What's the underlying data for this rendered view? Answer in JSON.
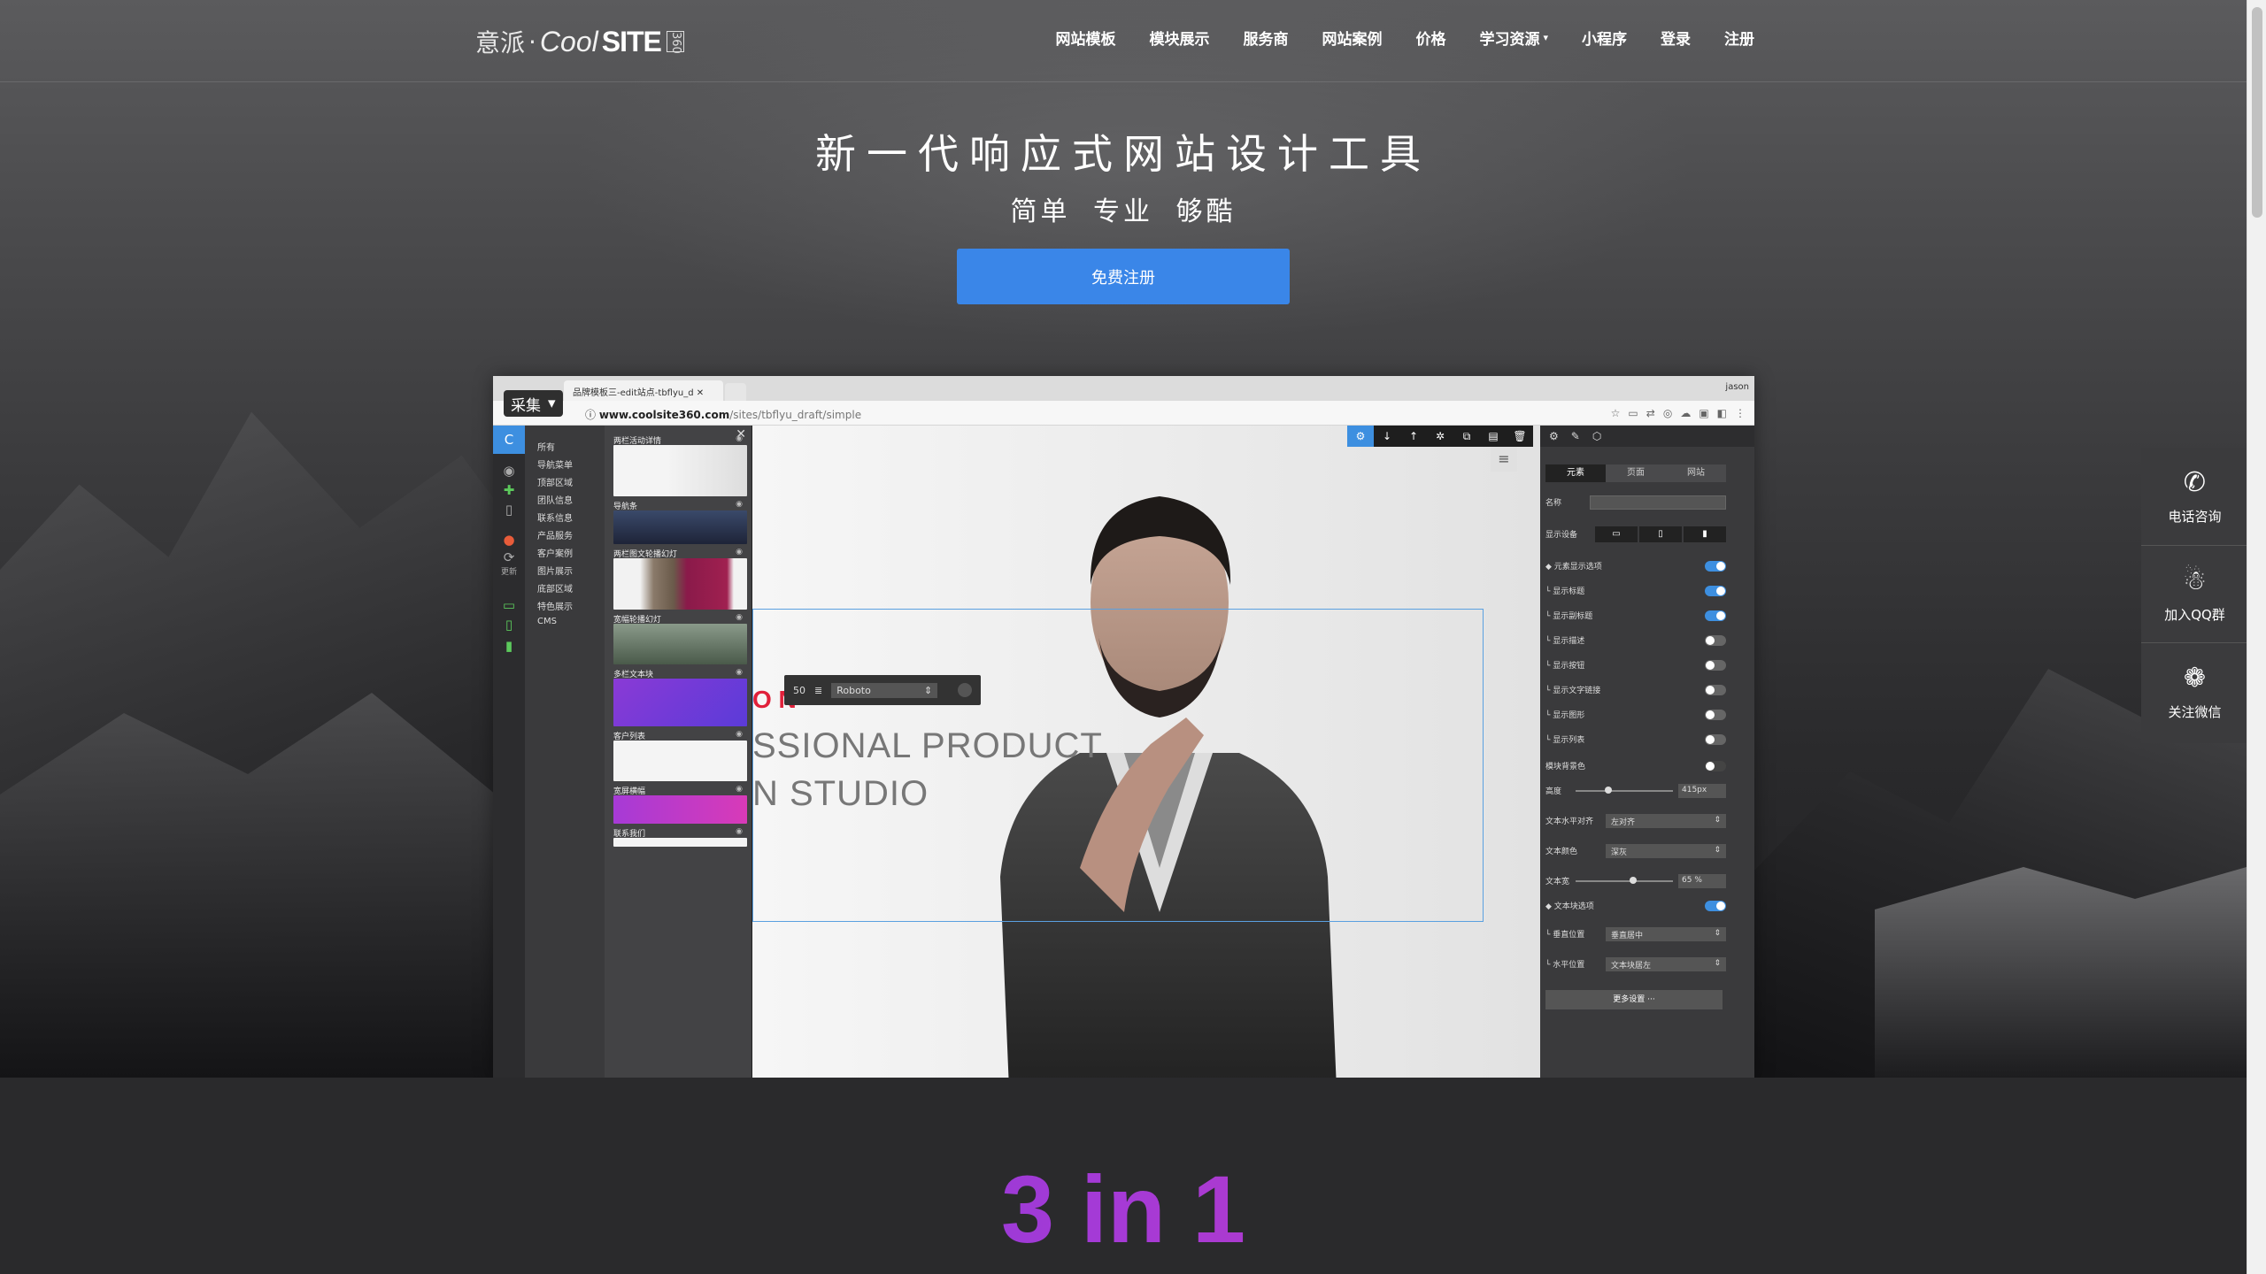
{
  "header": {
    "logo_cn": "意派",
    "logo_dot": "·",
    "logo_cool": "Cool",
    "logo_site": "SITE",
    "logo_360": "360",
    "nav": [
      {
        "label": "网站模板"
      },
      {
        "label": "模块展示"
      },
      {
        "label": "服务商"
      },
      {
        "label": "网站案例"
      },
      {
        "label": "价格"
      },
      {
        "label": "学习资源",
        "has_dropdown": true
      },
      {
        "label": "小程序"
      },
      {
        "label": "登录"
      },
      {
        "label": "注册"
      }
    ]
  },
  "hero": {
    "title": "新一代响应式网站设计工具",
    "subtitle": "简单 专业 够酷",
    "cta": "免费注册"
  },
  "mockup": {
    "collect_label": "采集",
    "tab_title": "品牌模板三-edit站点-tbflyu_d",
    "user": "jason",
    "url_host": "www.coolsite360.com",
    "url_path": "/sites/tbflyu_draft/simple",
    "iconbar_update": "更新",
    "categories": [
      "所有",
      "导航菜单",
      "顶部区域",
      "团队信息",
      "联系信息",
      "产品服务",
      "客户案例",
      "图片展示",
      "底部区域",
      "特色展示",
      "CMS"
    ],
    "thumbs": [
      {
        "label": "两栏活动详情"
      },
      {
        "label": "导航条"
      },
      {
        "label": "两栏图文轮播幻灯"
      },
      {
        "label": "宽幅轮播幻灯"
      },
      {
        "label": "多栏文本块"
      },
      {
        "label": "客户列表"
      },
      {
        "label": "宽屏横幅"
      },
      {
        "label": "联系我们"
      }
    ],
    "canvas": {
      "red_text": "O N",
      "line1": "SSIONAL PRODUCT",
      "line2": "N STUDIO",
      "font_size": "50",
      "font_name": "Roboto"
    },
    "props": {
      "tabs": [
        "元素",
        "页面",
        "网站"
      ],
      "name_label": "名称",
      "display_device": "显示设备",
      "rows": [
        {
          "label": "元素显示选项",
          "on": true
        },
        {
          "label": "显示标题",
          "on": true
        },
        {
          "label": "显示副标题",
          "on": true
        },
        {
          "label": "显示描述",
          "on": false
        },
        {
          "label": "显示按钮",
          "on": false
        },
        {
          "label": "显示文字链接",
          "on": false
        },
        {
          "label": "显示图形",
          "on": false
        },
        {
          "label": "显示列表",
          "on": false
        }
      ],
      "bg_color": "模块背景色",
      "height_label": "高度",
      "height_value": "415px",
      "text_align_label": "文本水平对齐",
      "text_align_value": "左对齐",
      "text_color_label": "文本颜色",
      "text_color_value": "深灰",
      "text_width_label": "文本宽",
      "text_width_value": "65",
      "text_width_unit": "%",
      "textblock_label": "文本块选项",
      "valign_label": "垂直位置",
      "valign_value": "垂直居中",
      "halign_label": "水平位置",
      "halign_value": "文本块居左",
      "more_button": "更多设置 ···"
    }
  },
  "side_widget": [
    {
      "label": "电话咨询",
      "icon": "phone-icon"
    },
    {
      "label": "加入QQ群",
      "icon": "qq-icon"
    },
    {
      "label": "关注微信",
      "icon": "wechat-icon"
    }
  ],
  "bottom": {
    "headline": "3 in 1"
  },
  "colors": {
    "cta": "#3a86e8",
    "accent_blue": "#3d8fe0",
    "headline_gradient_start": "#5b3bd8",
    "headline_gradient_end": "#d83a9a"
  }
}
